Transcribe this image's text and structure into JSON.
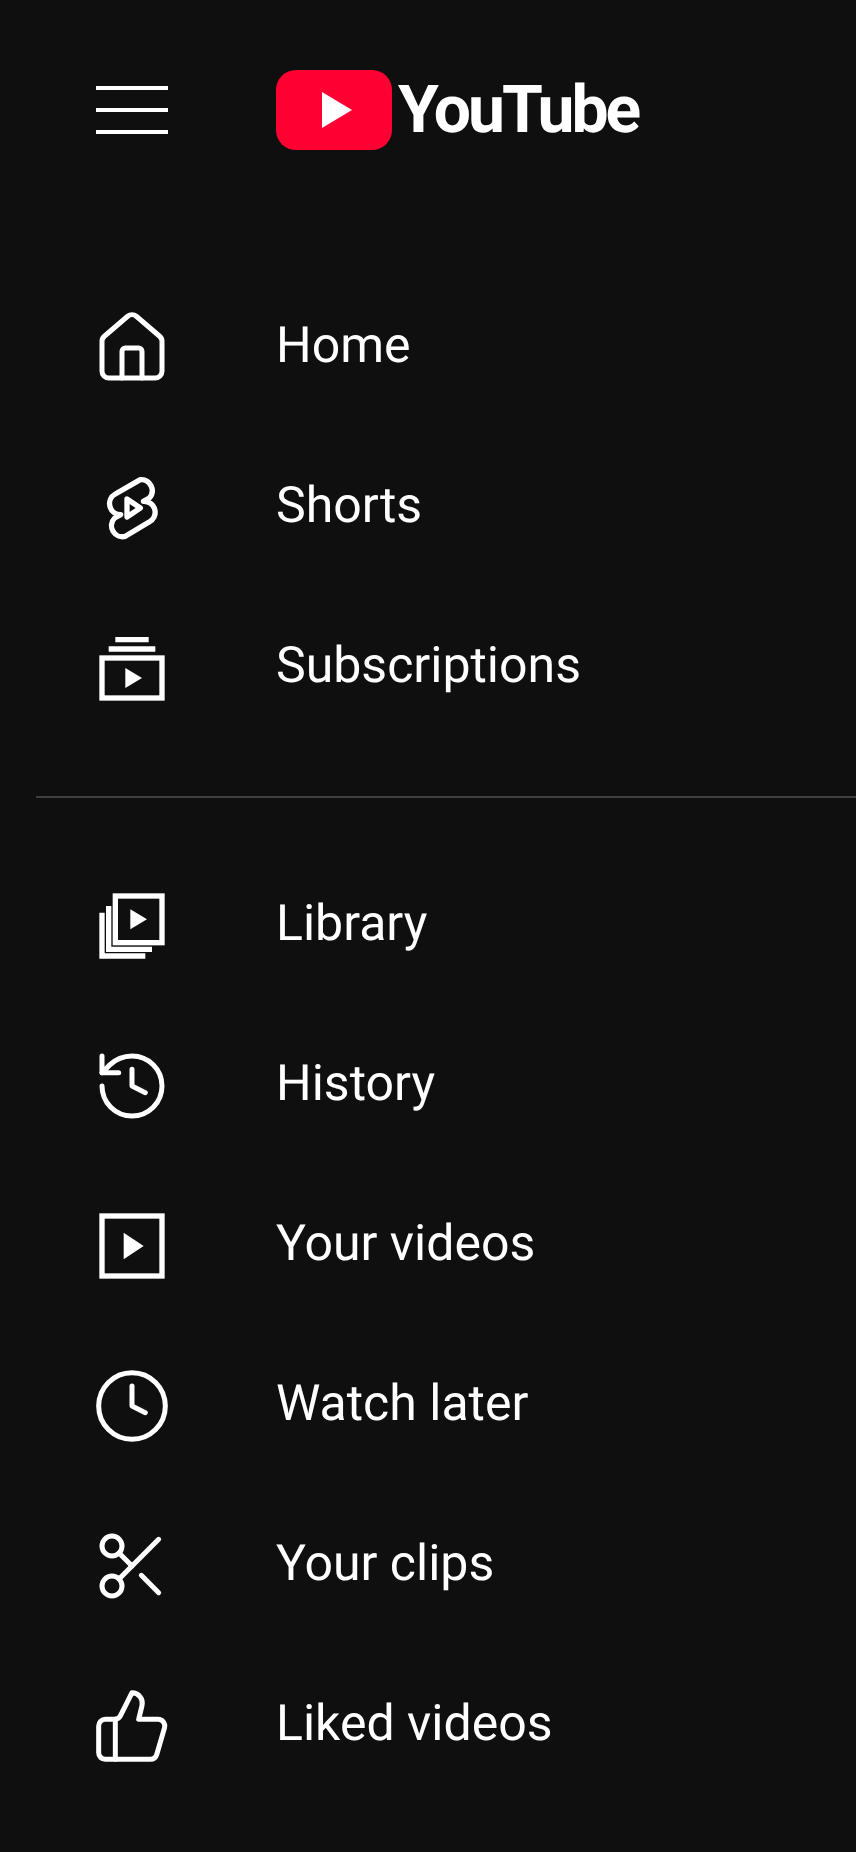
{
  "logo": {
    "text": "YouTube"
  },
  "sections": [
    {
      "items": [
        {
          "label": "Home"
        },
        {
          "label": "Shorts"
        },
        {
          "label": "Subscriptions"
        }
      ]
    },
    {
      "items": [
        {
          "label": "Library"
        },
        {
          "label": "History"
        },
        {
          "label": "Your videos"
        },
        {
          "label": "Watch later"
        },
        {
          "label": "Your clips"
        },
        {
          "label": "Liked videos"
        }
      ]
    }
  ]
}
